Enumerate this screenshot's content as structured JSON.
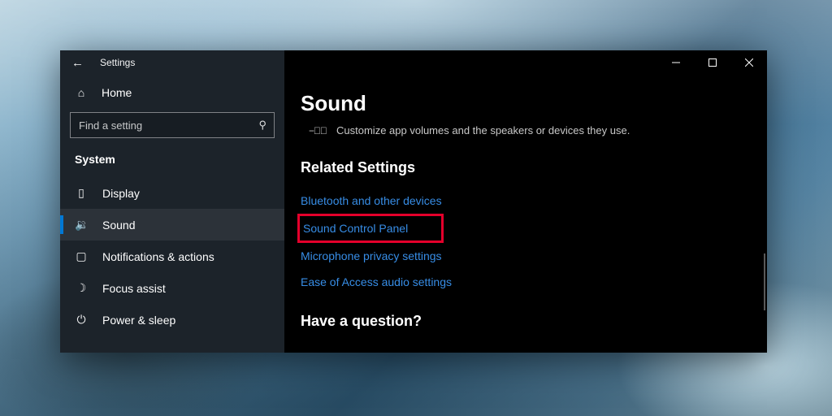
{
  "titlebar": {
    "app_name": "Settings"
  },
  "sidebar": {
    "home_label": "Home",
    "search_placeholder": "Find a setting",
    "category": "System",
    "items": [
      {
        "label": "Display"
      },
      {
        "label": "Sound"
      },
      {
        "label": "Notifications & actions"
      },
      {
        "label": "Focus assist"
      },
      {
        "label": "Power & sleep"
      }
    ]
  },
  "content": {
    "title": "Sound",
    "subtitle": "Customize app volumes and the speakers or devices they use.",
    "related_header": "Related Settings",
    "links": [
      "Bluetooth and other devices",
      "Sound Control Panel",
      "Microphone privacy settings",
      "Ease of Access audio settings"
    ],
    "question_header": "Have a question?"
  }
}
